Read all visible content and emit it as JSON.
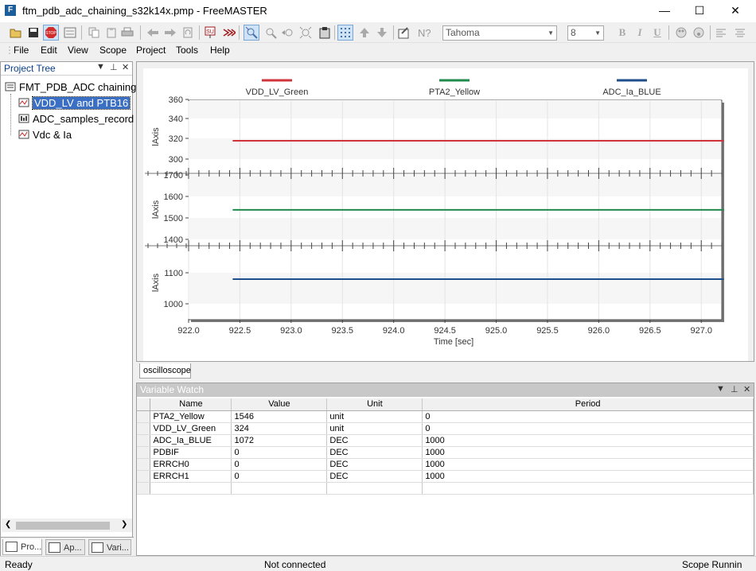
{
  "window": {
    "title": "ftm_pdb_adc_chaining_s32k14x.pmp - FreeMASTER",
    "app_icon": "F",
    "minimize": "—",
    "maximize": "☐",
    "close": "✕"
  },
  "toolbar": {
    "font_name": "Tahoma",
    "font_size": "8",
    "bold": "B",
    "italic": "I",
    "underline": "U"
  },
  "menu": [
    "File",
    "Edit",
    "View",
    "Scope",
    "Project",
    "Tools",
    "Help"
  ],
  "project_tree": {
    "title": "Project Tree",
    "items": [
      {
        "label": "FMT_PDB_ADC chaining",
        "icon": "project-icon"
      },
      {
        "label": "VDD_LV and PTB16",
        "icon": "scope-icon",
        "selected": true
      },
      {
        "label": "ADC_samples_record",
        "icon": "recorder-icon"
      },
      {
        "label": "Vdc & Ia",
        "icon": "scope-icon"
      }
    ],
    "bottom_tabs": [
      "Pro...",
      "Ap...",
      "Vari..."
    ]
  },
  "scope": {
    "tab": "oscilloscope",
    "legend": [
      {
        "name": "VDD_LV_Green",
        "color": "#d0343a"
      },
      {
        "name": "PTA2_Yellow",
        "color": "#1f8a4c"
      },
      {
        "name": "ADC_Ia_BLUE",
        "color": "#1f4e8c"
      }
    ],
    "y_axis_label": "lAxis",
    "x_axis_label": "Time [sec]",
    "x_ticks": [
      "922.0",
      "922.5",
      "923.0",
      "923.5",
      "924.0",
      "924.5",
      "925.0",
      "925.5",
      "926.0",
      "926.5",
      "927.0"
    ],
    "panes": [
      {
        "ticks": [
          "360",
          "340",
          "320",
          "300"
        ]
      },
      {
        "ticks": [
          "1700",
          "1600",
          "1500",
          "1400"
        ]
      },
      {
        "ticks": [
          "1100",
          "1000"
        ]
      }
    ]
  },
  "chart_data": {
    "type": "line",
    "x_label": "Time [sec]",
    "x_range": [
      922.0,
      927.2
    ],
    "series": [
      {
        "name": "VDD_LV_Green",
        "color": "#d0343a",
        "x": [
          922.43,
          927.22
        ],
        "y": [
          324,
          324
        ],
        "ylim": [
          295,
          360
        ]
      },
      {
        "name": "PTA2_Yellow",
        "color": "#1f8a4c",
        "x": [
          922.43,
          927.22
        ],
        "y": [
          1546,
          1546
        ],
        "ylim": [
          1375,
          1720
        ]
      },
      {
        "name": "ADC_Ia_BLUE",
        "color": "#1f4e8c",
        "x": [
          922.43,
          927.22
        ],
        "y": [
          1072,
          1072
        ],
        "ylim": [
          965,
          1160
        ]
      }
    ]
  },
  "watch": {
    "title": "Variable Watch",
    "columns": [
      "Name",
      "Value",
      "Unit",
      "Period"
    ],
    "rows": [
      [
        "PTA2_Yellow",
        "1546",
        "unit",
        "0"
      ],
      [
        "VDD_LV_Green",
        "324",
        "unit",
        "0"
      ],
      [
        "ADC_Ia_BLUE",
        "1072",
        "DEC",
        "1000"
      ],
      [
        "PDBIF",
        "0",
        "DEC",
        "1000"
      ],
      [
        "ERRCH0",
        "0",
        "DEC",
        "1000"
      ],
      [
        "ERRCH1",
        "0",
        "DEC",
        "1000"
      ]
    ]
  },
  "status": {
    "left": "Ready",
    "center": "Not connected",
    "right": "Scope Runnin"
  }
}
